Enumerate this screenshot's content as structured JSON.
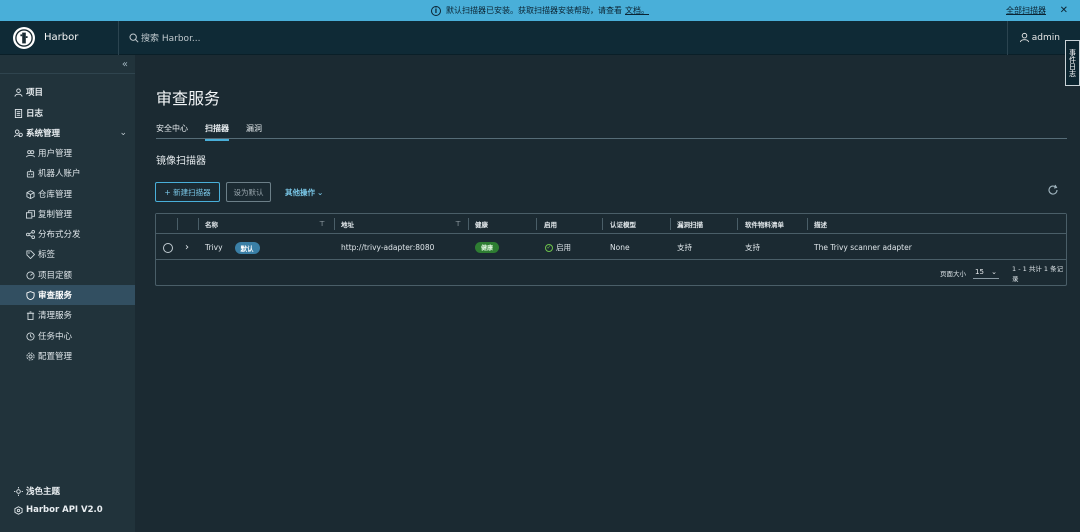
{
  "banner": {
    "message": "默认扫描器已安装。获取扫描器安装帮助，请查看",
    "link": "文档。",
    "all_scanners": "全部扫描器",
    "close": "✕"
  },
  "header": {
    "brand": "Harbor",
    "search_placeholder": "搜索 Harbor...",
    "user": "admin",
    "event_log": "事件日志"
  },
  "sidebar": {
    "collapse": "«",
    "items": [
      {
        "label": "项目",
        "icon": "projects-icon"
      },
      {
        "label": "日志",
        "icon": "logs-icon"
      },
      {
        "label": "系统管理",
        "icon": "admin-icon"
      }
    ],
    "sub_items": [
      {
        "label": "用户管理",
        "icon": "users-icon"
      },
      {
        "label": "机器人账户",
        "icon": "robot-icon"
      },
      {
        "label": "仓库管理",
        "icon": "registry-icon"
      },
      {
        "label": "复制管理",
        "icon": "replication-icon"
      },
      {
        "label": "分布式分发",
        "icon": "distribution-icon"
      },
      {
        "label": "标签",
        "icon": "tag-icon"
      },
      {
        "label": "项目定额",
        "icon": "quota-icon"
      },
      {
        "label": "审查服务",
        "icon": "shield-icon"
      },
      {
        "label": "清理服务",
        "icon": "trash-icon"
      },
      {
        "label": "任务中心",
        "icon": "tasks-icon"
      },
      {
        "label": "配置管理",
        "icon": "config-icon"
      }
    ],
    "theme": "浅色主题",
    "api": "Harbor API V2.0"
  },
  "main": {
    "title": "审查服务",
    "tabs": [
      "安全中心",
      "扫描器",
      "漏洞"
    ],
    "active_tab": "扫描器",
    "section_title": "镜像扫描器",
    "buttons": {
      "new_scanner": "+ 新建扫描器",
      "set_default": "设为默认",
      "other_actions": "其他操作"
    },
    "table": {
      "columns": [
        "名称",
        "地址",
        "健康",
        "启用",
        "认证模型",
        "漏洞扫描",
        "软件物料清单",
        "描述"
      ],
      "rows": [
        {
          "name": "Trivy",
          "default_badge": "默认",
          "endpoint": "http://trivy-adapter:8080",
          "health": "健康",
          "enabled": "启用",
          "auth": "None",
          "vuln_scan": "支持",
          "sbom": "支持",
          "description": "The Trivy scanner adapter"
        }
      ],
      "footer": {
        "page_size_label": "页面大小",
        "page_size": "15",
        "summary": "1 - 1 共计 1 条记录"
      }
    }
  },
  "colors": {
    "accent": "#49afd9",
    "sidebar_bg": "#21333b",
    "header_bg": "#0f2a36",
    "main_bg": "#1b2a32",
    "active_nav": "#324f61",
    "health_green": "#2e7d32"
  }
}
